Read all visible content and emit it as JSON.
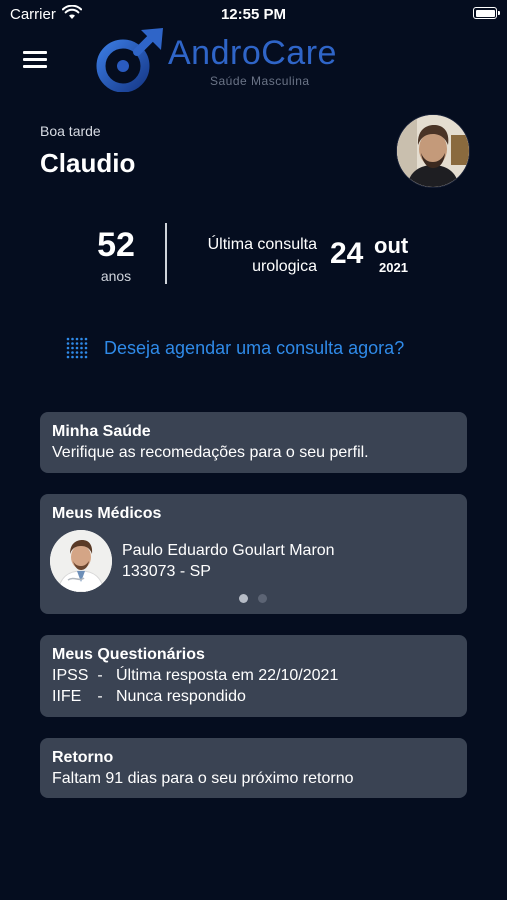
{
  "status_bar": {
    "carrier": "Carrier",
    "time": "12:55 PM"
  },
  "logo": {
    "name_part1": "Andro",
    "name_part2": "Care",
    "subtitle": "Saúde Masculina"
  },
  "profile": {
    "greeting": "Boa tarde",
    "name": "Claudio",
    "age": "52",
    "age_unit": "anos"
  },
  "last_consult": {
    "label": "Última consulta urologica",
    "day": "24",
    "month": "out",
    "year": "2021"
  },
  "schedule_link": "Deseja agendar uma consulta agora?",
  "cards": {
    "health": {
      "title": "Minha Saúde",
      "text": "Verifique as recomedações para o seu perfil."
    },
    "doctors": {
      "title": "Meus Médicos",
      "doctor_name": "Paulo Eduardo Goulart Maron",
      "doctor_crm": "133073 - SP",
      "page_count": 2,
      "current_page": 1
    },
    "questionnaires": {
      "title": "Meus Questionários",
      "items": [
        {
          "code": "IPSS",
          "separator": "-",
          "status": "Última resposta em 22/10/2021"
        },
        {
          "code": "IIFE",
          "separator": "-",
          "status": "Nunca respondido"
        }
      ]
    },
    "return": {
      "title": "Retorno",
      "text": "Faltam 91 dias para o seu próximo retorno"
    }
  },
  "colors": {
    "background": "#050d1f",
    "card": "#3a4353",
    "accent": "#2f8ae8",
    "brand": "#2f65c8"
  },
  "icons": [
    "wifi-icon",
    "battery-icon",
    "menu-icon",
    "logo-icon",
    "grid-icon"
  ]
}
